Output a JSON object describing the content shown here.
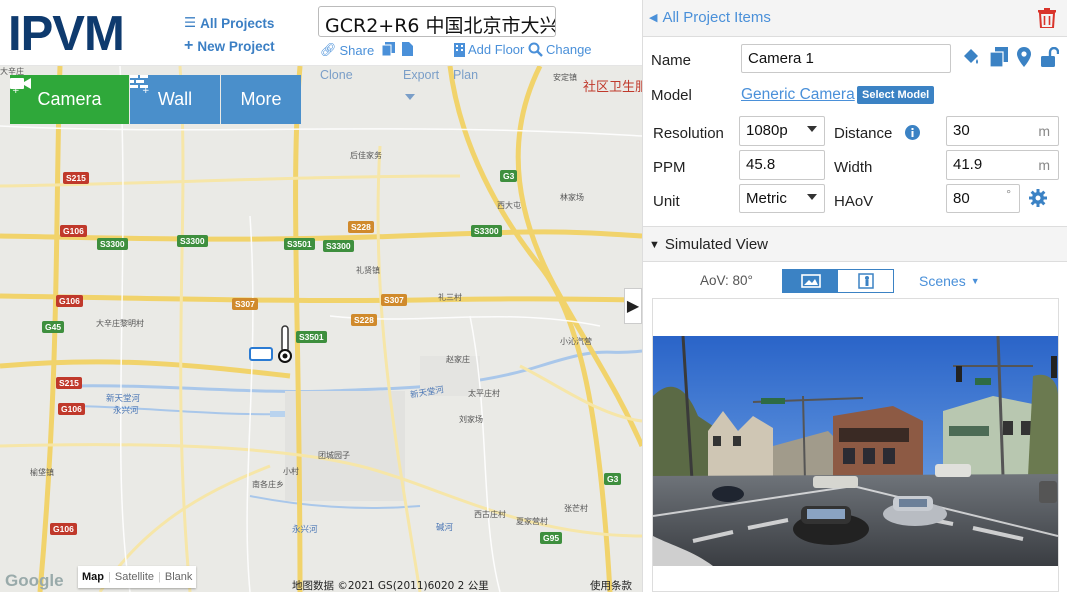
{
  "header": {
    "logo": "IPVM",
    "all_projects": "All Projects",
    "new_project": "New Project",
    "project_title": "GCR2+R6 中国北京市大兴",
    "share": "Share",
    "add_floor": "Add Floor",
    "change": "Change"
  },
  "map": {
    "buttons": {
      "camera": "Camera",
      "wall": "Wall",
      "more": "More"
    },
    "sub_tools": {
      "clone": "Clone",
      "export": "Export",
      "plan": "Plan"
    },
    "type_options": [
      "Map",
      "Satellite",
      "Blank"
    ],
    "attribution": "地图数据 ©2021 GS(2011)6020   2 公里",
    "terms": "使用条款",
    "google": "Google",
    "top_right_label": "社区卫生服",
    "road_badges": [
      {
        "text": "S215",
        "style": "red"
      },
      {
        "text": "G106",
        "style": "red"
      },
      {
        "text": "S3300",
        "style": "green"
      },
      {
        "text": "S3300",
        "style": "green"
      },
      {
        "text": "S3501",
        "style": "green"
      },
      {
        "text": "S3300",
        "style": "green"
      },
      {
        "text": "S228",
        "style": "orange"
      },
      {
        "text": "S3300",
        "style": "green"
      },
      {
        "text": "G3",
        "style": "green"
      },
      {
        "text": "G106",
        "style": "red"
      },
      {
        "text": "S307",
        "style": "orange"
      },
      {
        "text": "S307",
        "style": "orange"
      },
      {
        "text": "S228",
        "style": "orange"
      },
      {
        "text": "S3501",
        "style": "green"
      },
      {
        "text": "G45",
        "style": "green"
      },
      {
        "text": "S215",
        "style": "red"
      },
      {
        "text": "G106",
        "style": "red"
      },
      {
        "text": "G106",
        "style": "red"
      },
      {
        "text": "G3",
        "style": "green"
      },
      {
        "text": "G95",
        "style": "green"
      }
    ],
    "places": [
      "后佳家务",
      "林家场",
      "西大屯",
      "礼贤镇",
      "礼三村",
      "大辛庄黎明村",
      "小沁汽营",
      "赵家庄",
      "太平庄村",
      "刘家场",
      "团城园子",
      "小村",
      "南各庄乡",
      "榆垡镇",
      "西古庄村",
      "夏家营村",
      "张芒村",
      "安定镇",
      "大辛庄"
    ],
    "rivers": [
      "新天堂河",
      "永兴河",
      "新天堂河",
      "永兴河",
      "碱河"
    ]
  },
  "panel": {
    "back": "All Project Items",
    "labels": {
      "name": "Name",
      "model": "Model",
      "resolution": "Resolution",
      "distance": "Distance",
      "ppm": "PPM",
      "width": "Width",
      "unit": "Unit",
      "haov": "HAoV"
    },
    "values": {
      "name": "Camera 1",
      "model": "Generic Camera",
      "select_model": "Select Model",
      "resolution": "1080p",
      "distance": "30",
      "distance_unit": "m",
      "ppm": "45.8",
      "width": "41.9",
      "width_unit": "m",
      "unit": "Metric",
      "haov": "80",
      "haov_unit": "°"
    },
    "simulated_view": {
      "title": "Simulated View",
      "aov_label": "AoV: 80°",
      "scenes": "Scenes"
    }
  },
  "colors": {
    "accent": "#4a90d9",
    "camera_green": "#2fa83a",
    "wall_blue": "#4a8fcb",
    "delete_red": "#d9342b"
  }
}
